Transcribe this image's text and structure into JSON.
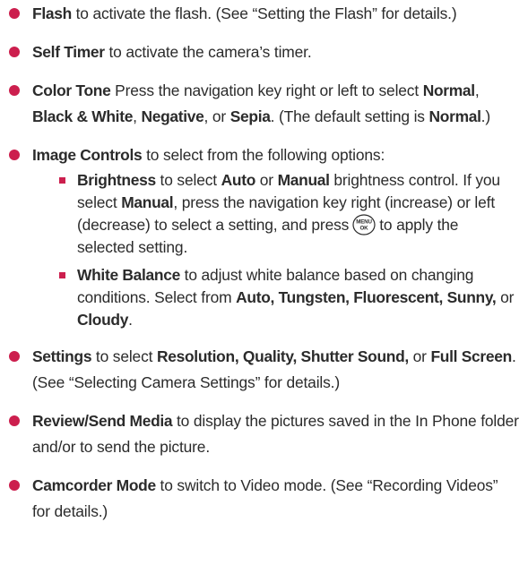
{
  "colors": {
    "bullet_accent": "#cc1f4e",
    "text": "#2b2b2b"
  },
  "icons": {
    "menu_ok_key": "menu-ok-key-icon"
  },
  "items": [
    {
      "term": "Flash",
      "text": " to activate the flash. (See “Setting the Flash” for details.)"
    },
    {
      "term": "Self Timer",
      "text": " to activate the camera’s timer."
    },
    {
      "term": "Color Tone",
      "t1": " Press the navigation key right or left to select ",
      "o1": "Normal",
      "t2": ", ",
      "o2": "Black & White",
      "t3": ", ",
      "o3": "Negative",
      "t4": ", or ",
      "o4": "Sepia",
      "t5": ". (The default setting is ",
      "o5": "Normal",
      "t6": ".)"
    },
    {
      "term": "Image Controls",
      "text": " to select from the following options:",
      "sub": [
        {
          "term": "Brightness",
          "t1": " to select ",
          "o1": "Auto",
          "t2": " or ",
          "o2": "Manual",
          "t3": " brightness control. If you select ",
          "o3": "Manual",
          "t4": ", press the navigation key right (increase) or left (decrease) to select a setting, and press",
          "key_glyph": "MENU OK",
          "t5": "to apply the selected setting."
        },
        {
          "term": "White Balance",
          "t1": " to adjust white balance based on changing conditions. Select from ",
          "o1": "Auto, Tungsten, Fluorescent, Sunny,",
          "t2": " or ",
          "o2": "Cloudy",
          "t3": "."
        }
      ]
    },
    {
      "term": "Settings",
      "t1": " to select ",
      "o1": "Resolution, Quality, Shutter Sound,",
      "t2": " or ",
      "o2": "Full Screen",
      "t3": ". (See “Selecting Camera Settings” for details.)"
    },
    {
      "term": "Review/Send Media",
      "text": " to display the pictures saved in the In Phone folder and/or to send the picture."
    },
    {
      "term": "Camcorder Mode",
      "text": " to switch to Video mode. (See “Recording Videos” for details.)"
    }
  ]
}
